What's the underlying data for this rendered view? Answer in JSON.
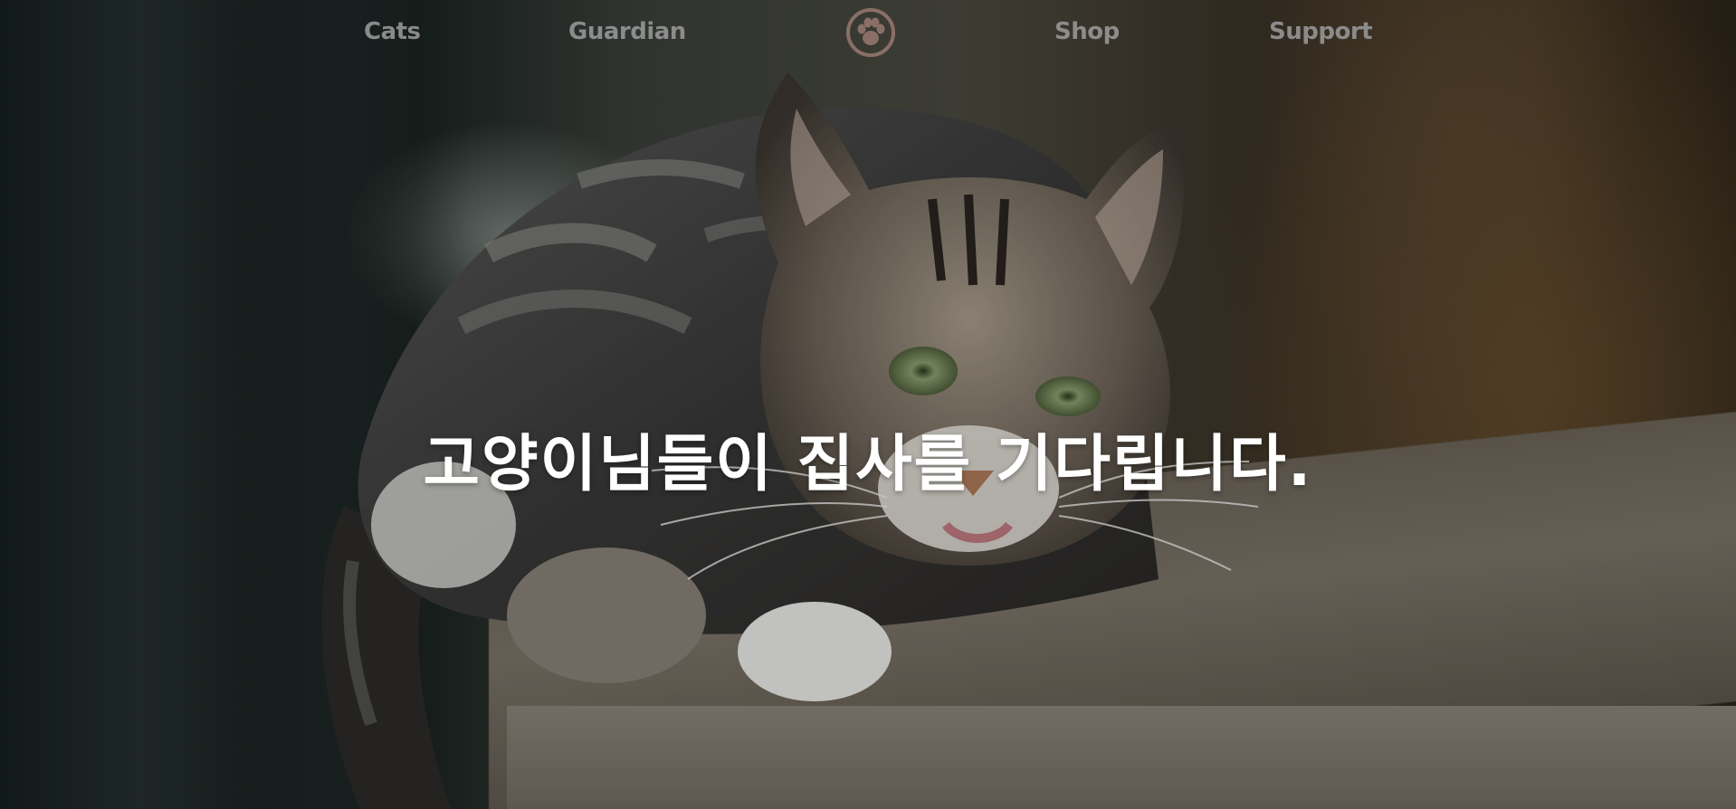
{
  "nav": {
    "items": [
      {
        "label": "Cats"
      },
      {
        "label": "Guardian"
      },
      {
        "label": "Shop"
      },
      {
        "label": "Support"
      }
    ],
    "logo_icon": "paw-icon"
  },
  "hero": {
    "headline": "고양이님들이 집사를 기다립니다.",
    "background": "tabby-cat-photo"
  },
  "colors": {
    "nav_text": "#969696",
    "logo": "#8a6f66",
    "headline": "#ffffff"
  }
}
